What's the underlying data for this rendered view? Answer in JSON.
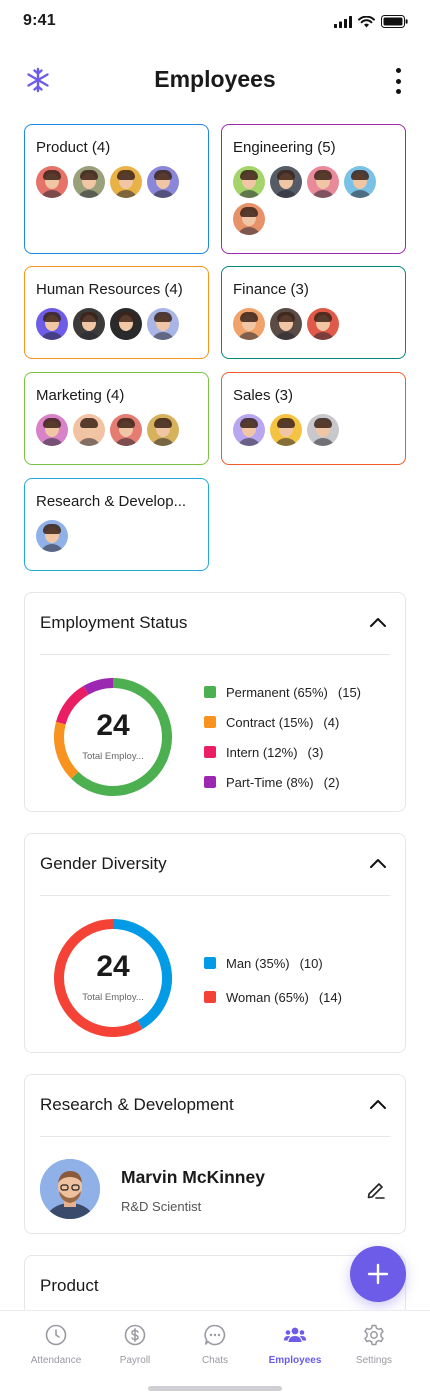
{
  "status_bar": {
    "time": "9:41"
  },
  "header": {
    "title": "Employees",
    "logo_icon": "snowflake-logo-icon",
    "menu_icon": "more-vertical-icon"
  },
  "departments": [
    {
      "name": "Product (4)",
      "color": "#1e88e5",
      "avatars": [
        "#e5736a",
        "#9aa07a",
        "#e8b247",
        "#8a86d8"
      ]
    },
    {
      "name": "Engineering (5)",
      "color": "#9c27b0",
      "avatars": [
        "#a5d46a",
        "#555c66",
        "#e88a9a",
        "#7ac1e6",
        "#e8926a"
      ]
    },
    {
      "name": "Human Resources (4)",
      "color": "#f7931e",
      "avatars": [
        "#6c5ce7",
        "#3b3b3b",
        "#2a2a2a",
        "#a8b5e6"
      ]
    },
    {
      "name": "Finance (3)",
      "color": "#00897b",
      "avatars": [
        "#f0a36b",
        "#5a4b45",
        "#e05a4a"
      ]
    },
    {
      "name": "Marketing (4)",
      "color": "#7cc243",
      "avatars": [
        "#d882c8",
        "#f2c2a3",
        "#e57c72",
        "#d6b25c"
      ]
    },
    {
      "name": "Sales (3)",
      "color": "#f05a28",
      "avatars": [
        "#b8a6f0",
        "#f5c342",
        "#c8c8cc"
      ]
    },
    {
      "name": "Research & Develop...",
      "color": "#26a9d9",
      "avatars": [
        "#8fb1e8"
      ]
    }
  ],
  "employment_status": {
    "title": "Employment Status",
    "total": "24",
    "total_label": "Total Employ...",
    "legend": [
      {
        "label": "Permanent (65%)",
        "count": "(15)",
        "color": "#4caf50",
        "value": 15
      },
      {
        "label": "Contract (15%)",
        "count": "(4)",
        "color": "#f7931e",
        "value": 4
      },
      {
        "label": "Intern (12%)",
        "count": "(3)",
        "color": "#e91e63",
        "value": 3
      },
      {
        "label": "Part-Time (8%)",
        "count": "(2)",
        "color": "#9c27b0",
        "value": 2
      }
    ]
  },
  "gender_diversity": {
    "title": "Gender Diversity",
    "total": "24",
    "total_label": "Total Employ...",
    "legend": [
      {
        "label": "Man (35%)",
        "count": "(10)",
        "color": "#039be5",
        "value": 10
      },
      {
        "label": "Woman (65%)",
        "count": "(14)",
        "color": "#f44336",
        "value": 14
      }
    ]
  },
  "rnd_section": {
    "title": "Research & Development",
    "person": {
      "name": "Marvin McKinney",
      "role": "R&D Scientist"
    }
  },
  "product_section": {
    "title": "Product"
  },
  "fab": {
    "icon": "plus-icon"
  },
  "nav": [
    {
      "label": "Attendance",
      "icon": "clock-icon",
      "active": false
    },
    {
      "label": "Payroll",
      "icon": "dollar-icon",
      "active": false
    },
    {
      "label": "Chats",
      "icon": "chat-icon",
      "active": false
    },
    {
      "label": "Employees",
      "icon": "users-icon",
      "active": true
    },
    {
      "label": "Settings",
      "icon": "gear-icon",
      "active": false
    }
  ],
  "accent_color": "#6c5ce7"
}
